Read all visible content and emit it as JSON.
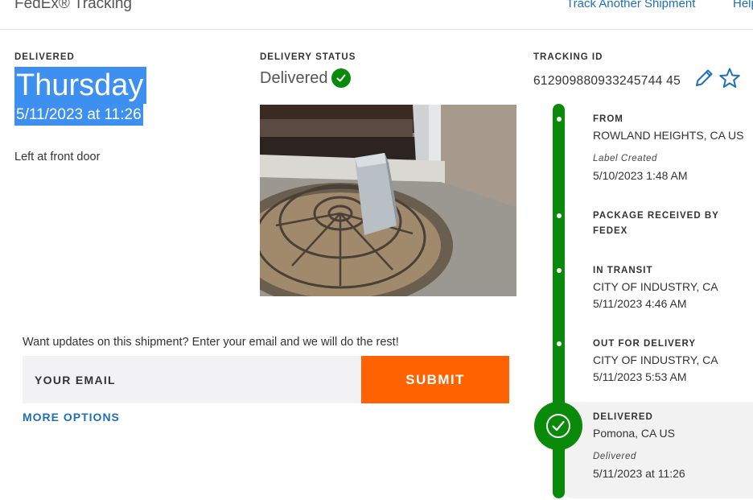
{
  "header": {
    "brand": "FedEx® Tracking",
    "track_another": "Track Another Shipment",
    "help": "Help"
  },
  "delivered": {
    "label": "DELIVERED",
    "day": "Thursday",
    "datetime": "5/11/2023 at 11:26",
    "note": "Left at front door"
  },
  "delivery_status": {
    "label": "DELIVERY STATUS",
    "value": "Delivered",
    "status_color": "#0a8a0a"
  },
  "tracking": {
    "label": "TRACKING ID",
    "id": "612909880933245744 45"
  },
  "email": {
    "prompt": "Want updates on this shipment? Enter your email and we will do the rest!",
    "placeholder": "YOUR EMAIL",
    "submit": "SUBMIT",
    "more_options": "MORE OPTIONS"
  },
  "timeline": {
    "from": {
      "title": "FROM",
      "place": "ROWLAND HEIGHTS, CA US",
      "note": "Label Created",
      "time": "5/10/2023 1:48 AM"
    },
    "received": {
      "title": "PACKAGE RECEIVED BY FEDEX"
    },
    "transit": {
      "title": "IN TRANSIT",
      "place": "CITY OF INDUSTRY, CA",
      "time": "5/11/2023 4:46 AM"
    },
    "out": {
      "title": "OUT FOR DELIVERY",
      "place": "CITY OF INDUSTRY, CA",
      "time": "5/11/2023 5:53 AM"
    },
    "delivered": {
      "title": "DELIVERED",
      "place": "Pomona, CA US",
      "note": "Delivered",
      "time": "5/11/2023 at 11:26"
    }
  },
  "colors": {
    "accent": "#ff6200",
    "link": "#1d6fb8",
    "success": "#0a8a0a",
    "highlight": "#3d8ff0"
  },
  "icons": {
    "status": "check-circle-icon",
    "edit": "pencil-icon",
    "favorite": "star-icon",
    "delivered": "check-circle-icon"
  }
}
